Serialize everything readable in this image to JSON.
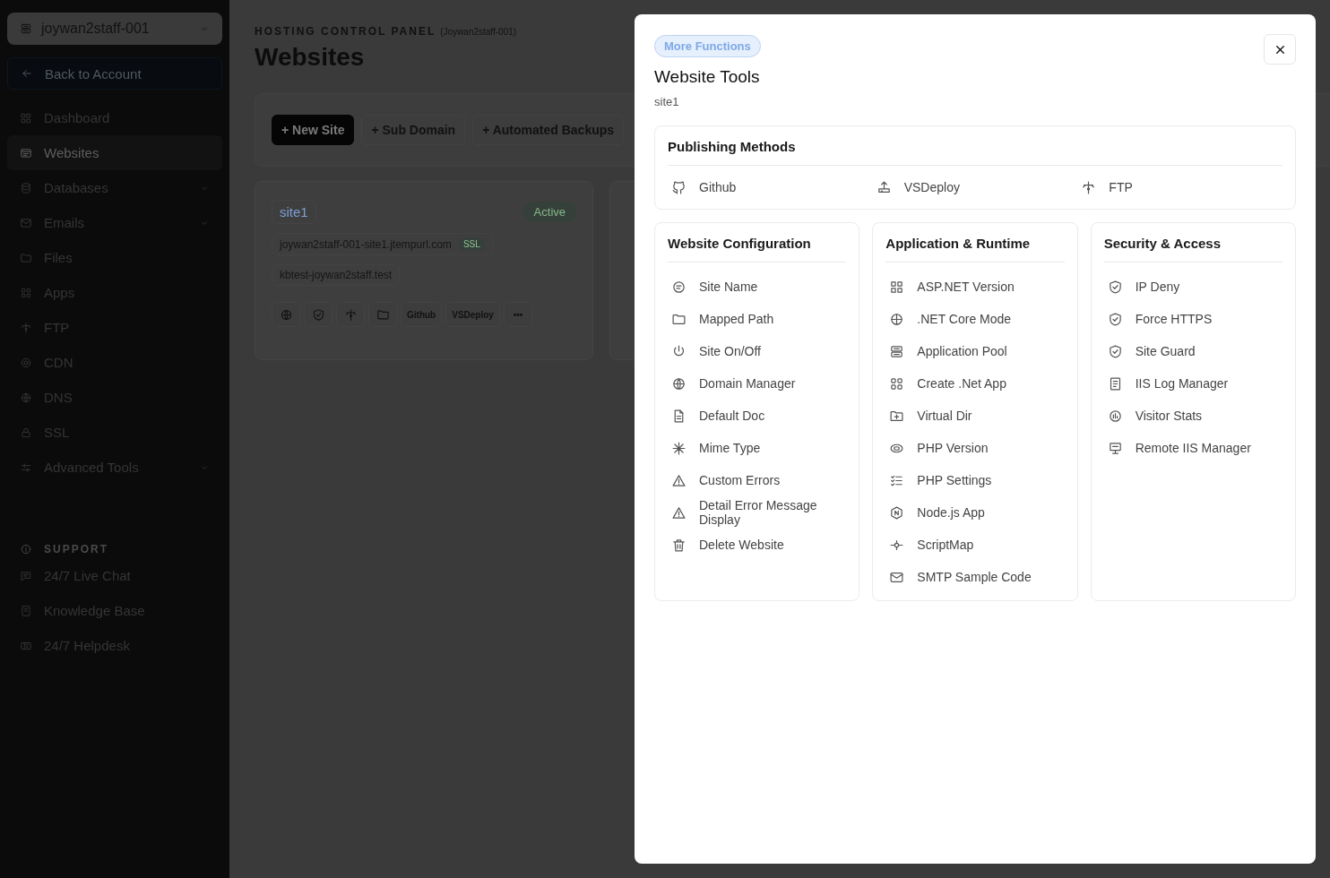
{
  "sidebar": {
    "account": "joywan2staff-001",
    "back_link": "Back to Account",
    "items": [
      {
        "label": "Dashboard",
        "selected": false,
        "expandable": false
      },
      {
        "label": "Websites",
        "selected": true,
        "expandable": false
      },
      {
        "label": "Databases",
        "selected": false,
        "expandable": true
      },
      {
        "label": "Emails",
        "selected": false,
        "expandable": true
      },
      {
        "label": "Files",
        "selected": false,
        "expandable": false
      },
      {
        "label": "Apps",
        "selected": false,
        "expandable": false
      },
      {
        "label": "FTP",
        "selected": false,
        "expandable": false
      },
      {
        "label": "CDN",
        "selected": false,
        "expandable": false
      },
      {
        "label": "DNS",
        "selected": false,
        "expandable": false
      },
      {
        "label": "SSL",
        "selected": false,
        "expandable": false
      },
      {
        "label": "Advanced Tools",
        "selected": false,
        "expandable": true
      }
    ],
    "support": {
      "heading": "SUPPORT",
      "items": [
        "24/7 Live Chat",
        "Knowledge Base",
        "24/7 Helpdesk"
      ]
    }
  },
  "header": {
    "eyebrow": "HOSTING CONTROL PANEL",
    "account": "(Joywan2staff-001)",
    "title": "Websites"
  },
  "toolbar": {
    "buttons": [
      {
        "label": "+ New Site",
        "primary": true
      },
      {
        "label": "+ Sub Domain",
        "primary": false
      },
      {
        "label": "+ Automated Backups",
        "primary": false
      }
    ]
  },
  "sites": [
    {
      "name": "site1",
      "status": "Active",
      "domains": [
        {
          "host": "joywan2staff-001-site1.jtempurl.com",
          "ssl": "SSL"
        },
        {
          "host": "kbtest-joywan2staff.test"
        }
      ],
      "actions": [
        "Github",
        "VSDeploy",
        "•••"
      ]
    }
  ],
  "modal": {
    "badge": "More Functions",
    "title": "Website Tools",
    "subtitle": "site1",
    "publishing": {
      "title": "Publishing Methods",
      "items": [
        "Github",
        "VSDeploy",
        "FTP"
      ]
    },
    "columns": [
      {
        "title": "Website Configuration",
        "items": [
          "Site Name",
          "Mapped Path",
          "Site On/Off",
          "Domain Manager",
          "Default Doc",
          "Mime Type",
          "Custom Errors",
          "Detail Error Message Display",
          "Delete Website"
        ]
      },
      {
        "title": "Application & Runtime",
        "items": [
          "ASP.NET Version",
          ".NET Core Mode",
          "Application Pool",
          "Create .Net App",
          "Virtual Dir",
          "PHP Version",
          "PHP Settings",
          "Node.js App",
          "ScriptMap",
          "SMTP Sample Code"
        ]
      },
      {
        "title": "Security & Access",
        "items": [
          "IP Deny",
          "Force HTTPS",
          "Site Guard",
          "IIS Log Manager",
          "Visitor Stats",
          "Remote IIS Manager"
        ]
      }
    ]
  }
}
